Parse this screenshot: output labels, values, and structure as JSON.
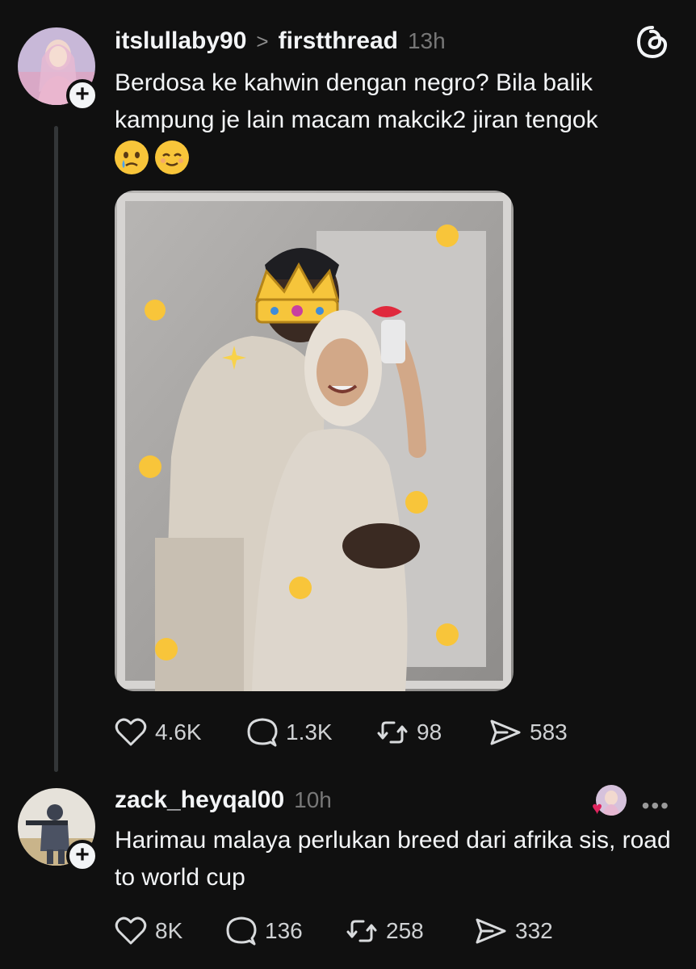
{
  "posts": [
    {
      "username": "itslullaby90",
      "separator": ">",
      "thread": "firstthread",
      "time": "13h",
      "text": "Berdosa ke kahwin dengan negro? Bila balik kampung je lain macam makcik2 jiran tengok",
      "emojis": [
        "crying-face-emoji",
        "relieved-face-emoji"
      ],
      "stats": {
        "likes": "4.6K",
        "replies": "1.3K",
        "reposts": "98",
        "shares": "583"
      }
    },
    {
      "username": "zack_heyqal00",
      "time": "10h",
      "text": "Harimau malaya perlukan breed dari afrika sis, road to world cup",
      "stats": {
        "likes": "8K",
        "replies": "136",
        "reposts": "258",
        "shares": "332"
      }
    }
  ],
  "icons": {
    "like": "heart-icon",
    "reply": "comment-icon",
    "repost": "repost-icon",
    "share": "share-icon",
    "follow": "plus-icon",
    "app": "threads-logo-icon",
    "more": "more-icon"
  },
  "colors": {
    "background": "#101010",
    "text": "#f3f5f7",
    "muted": "#777777",
    "heart": "#e0245e"
  }
}
